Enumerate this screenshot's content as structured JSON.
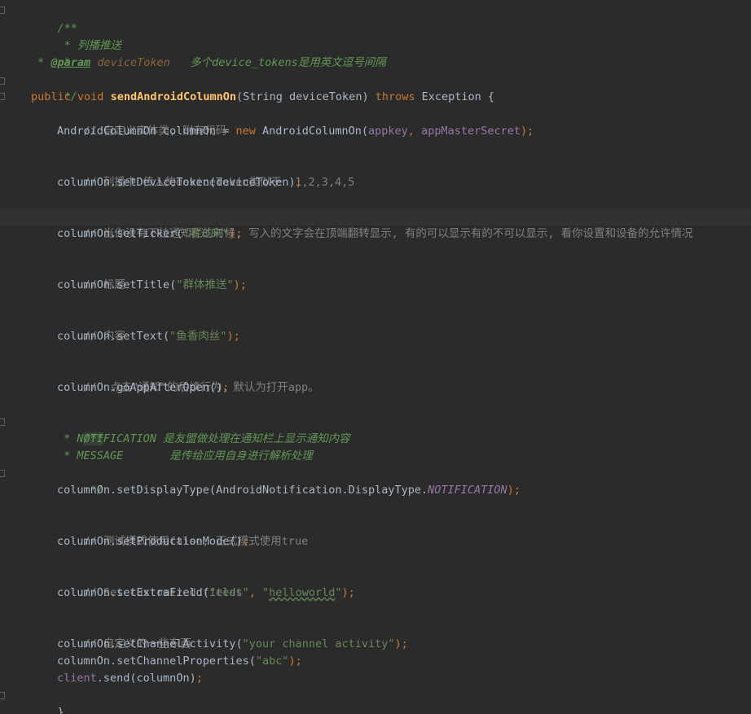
{
  "code": {
    "doc_open": "/**",
    "doc_line_1": " * 列播推送",
    "doc_line_2": " *",
    "doc_param_prefix": " * ",
    "doc_param_tag": "@param",
    "doc_param_name": "deviceToken",
    "doc_param_desc": "   多个device_tokens是用英文逗号间隔",
    "doc_close": " */",
    "sig_public": "public",
    "sig_void": "void",
    "sig_method": "sendAndroidColumnOn",
    "sig_params": "(String deviceToken)",
    "sig_throws": "throws",
    "sig_exception": "Exception {",
    "comment_1": "// 自定义实体类, 附有代码",
    "decl_type": "AndroidColumnOn columnOn = ",
    "decl_new": "new",
    "decl_ctor": " AndroidColumnOn(",
    "decl_arg1": "appkey",
    "decl_sep": ", ",
    "decl_arg2": "appMasterSecret",
    "decl_end": ");",
    "comment_2": "// 列播中 传入的deviceToken类似于  1,2,3,4,5",
    "call_token": "columnOn.setDeviceToken(deviceToken)",
    "semi": ";",
    "comment_3": "// 当你没有下拉通知栏的时候, 写入的文字会在顶端翻转显示, 有的可以显示有的不可以显示, 看你设置和设备的允许情况",
    "call_ticker_pre": "columnOn.setTicker(",
    "call_ticker_arg": "\"看过来\"",
    "close_paren_semi": ");",
    "comment_4": "// 标题",
    "call_title_pre": "columnOn.setTitle(",
    "call_title_arg": "\"群体推送\"",
    "comment_5": "// 内容",
    "call_text_pre": "columnOn.setText(",
    "call_text_arg": "\"鱼香肉丝\"",
    "comment_6": "//  点击\"通知\"的后续行为，默认为打开app。",
    "call_goapp": "columnOn.goAppAfterOpen()",
    "inner_doc_open": "/**",
    "inner_doc_1_star": " * ",
    "inner_doc_1_key": "NOTIFICATION",
    "inner_doc_1_desc": " 是友盟做处理在通知栏上显示通知内容",
    "inner_doc_2_star": " * ",
    "inner_doc_2_key": "MESSAGE",
    "inner_doc_2_desc": "       是传给应用自身进行解析处理",
    "inner_doc_close": " */",
    "call_display_pre": "columnOn.setDisplayType(AndroidNotification.DisplayType.",
    "call_display_const": "NOTIFICATION",
    "comment_7": "// 测试模式使用false, 正式模式使用true",
    "call_production": "columnOn.setProductionMode()",
    "comment_8": "// Set customized fields",
    "call_extra_pre": "columnOn.setExtraField(",
    "call_extra_arg1": "\"test\"",
    "call_extra_sep": ", ",
    "call_extra_q1": "\"",
    "call_extra_arg2": "helloworld",
    "call_extra_q2": "\"",
    "comment_9": "// 自定义的一些东西",
    "call_channel_act_pre": "columnOn.setChannelActivity(",
    "call_channel_act_arg": "\"your channel activity\"",
    "call_channel_prop_pre": "columnOn.setChannelProperties(",
    "call_channel_prop_arg": "\"abc\"",
    "call_send_field": "client",
    "call_send_rest": ".send(columnOn)",
    "close_brace": "}"
  },
  "colors": {
    "background": "#2b2b2b",
    "current_line": "#323232",
    "default_text": "#a9b7c6",
    "comment": "#808080",
    "doc_comment": "#629755",
    "keyword": "#cc7832",
    "method_declaration": "#ffc66d",
    "string": "#6a8759",
    "field": "#9876aa"
  }
}
